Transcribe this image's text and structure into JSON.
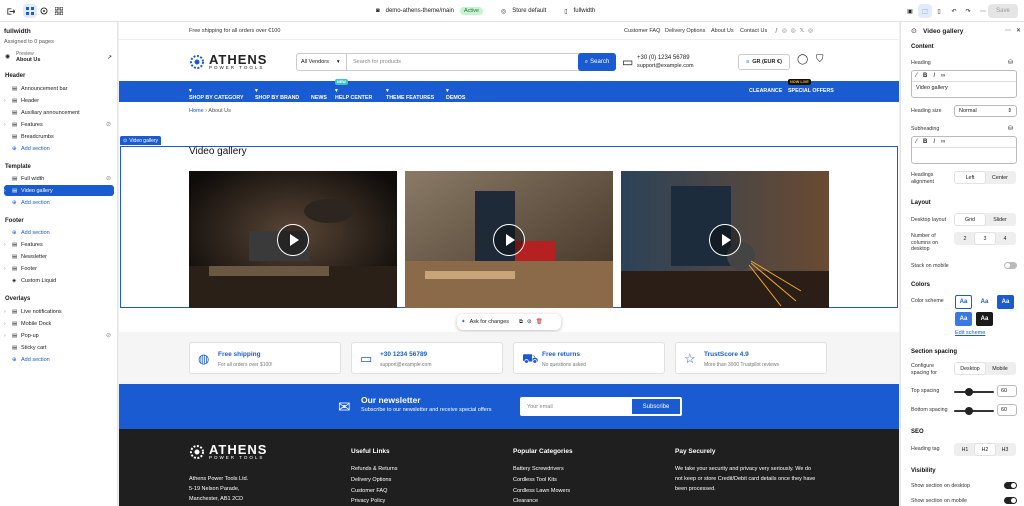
{
  "topbar": {
    "theme": "demo-athens-theme/main",
    "status": "Active",
    "store": "Store default",
    "template": "fullwidth",
    "save": "Save"
  },
  "left": {
    "title": "fullwidth",
    "assigned": "Assigned to 0 pages",
    "preview_label": "Preview",
    "preview_page": "About Us",
    "header_group": "Header",
    "header_items": [
      "Announcement bar",
      "Header",
      "Auxiliary announcement",
      "Features",
      "Breadcrumbs"
    ],
    "template_group": "Template",
    "template_items": [
      "Full width",
      "Video gallery"
    ],
    "footer_group": "Footer",
    "footer_items": [
      "Features",
      "Newsletter",
      "Footer",
      "Custom Liquid"
    ],
    "overlays_group": "Overlays",
    "overlay_items": [
      "Live notifications",
      "Mobile Dock",
      "Pop-up",
      "Sticky cart"
    ],
    "add_section": "Add section"
  },
  "store": {
    "shipping_msg": "Free shipping for all orders over €100",
    "top_links": [
      "Customer FAQ",
      "Delivery Options",
      "About Us",
      "Contact Us"
    ],
    "logo_name": "ATHENS",
    "logo_sub": "POWER TOOLS",
    "vendors": "All Vendors",
    "search_placeholder": "Search for products",
    "search_btn": "Search",
    "phone": "+30 (0) 1234 56789",
    "email": "support@example.com",
    "currency": "GR (EUR €)",
    "nav": [
      "SHOP BY CATEGORY",
      "SHOP BY BRAND",
      "NEWS",
      "HELP CENTER",
      "THEME FEATURES",
      "DEMOS",
      "CLEARANCE",
      "SPECIAL OFFERS"
    ],
    "tag_new": "NEW",
    "tag_live": "NOW LIVE",
    "crumb_home": "Home",
    "crumb_sep": "›",
    "crumb_page": "About Us",
    "section_label": "Video gallery",
    "gallery_title": "Video gallery",
    "ask": "Ask for changes",
    "features": [
      {
        "title": "Free shipping",
        "desc": "For all orders over $100!"
      },
      {
        "title": "+30 1234 56789",
        "desc": "support@example.com"
      },
      {
        "title": "Free returns",
        "desc": "No questions asked"
      },
      {
        "title": "TrustScore 4.9",
        "desc": "More than 3000 Trustpilot reviews"
      }
    ],
    "newsletter_title": "Our newsletter",
    "newsletter_sub": "Subscribe to our newsletter and receive special offers",
    "newsletter_placeholder": "Your email",
    "newsletter_btn": "Subscribe",
    "footer_address": [
      "Athens Power Tools Ltd.",
      "5-19 Nelson Parade,",
      "Manchester, AB1 2CD"
    ],
    "footer_h1": "Useful Links",
    "footer_links1": [
      "Refunds & Returns",
      "Delivery Options",
      "Customer FAQ",
      "Privacy Policy"
    ],
    "footer_h2": "Popular Categories",
    "footer_links2": [
      "Battery Screwdrivers",
      "Cordless Tool Kits",
      "Cordless Lawn Mowers",
      "Clearance"
    ],
    "footer_h3": "Pay Securely",
    "footer_pay": [
      "We take your security and privacy very seriously. We do",
      "not keep or store Credit/Debit card details once they have",
      "been processed."
    ]
  },
  "right": {
    "title": "Video gallery",
    "content": "Content",
    "heading": "Heading",
    "heading_value": "Video gallery",
    "heading_size": "Heading size",
    "heading_size_value": "Normal",
    "subheading": "Subheading",
    "align_label": "Headings alignment",
    "align": [
      "Left",
      "Center"
    ],
    "layout": "Layout",
    "desktop_layout": "Desktop layout",
    "layout_opts": [
      "Grid",
      "Slider"
    ],
    "columns_label": "Number of columns on desktop",
    "columns": [
      "2",
      "3",
      "4"
    ],
    "stack": "Stack on mobile",
    "colors": "Colors",
    "scheme": "Color scheme",
    "edit_scheme": "Edit scheme",
    "spacing": "Section spacing",
    "configure": "Configure spacing for",
    "spacing_opts": [
      "Desktop",
      "Mobile"
    ],
    "top": "Top spacing",
    "top_val": "60",
    "bottom": "Bottom spacing",
    "bottom_val": "60",
    "seo": "SEO",
    "heading_tag": "Heading tag",
    "tags": [
      "H1",
      "H2",
      "H3"
    ],
    "visibility": "Visibility",
    "show_desktop": "Show section on desktop",
    "show_mobile": "Show section on mobile"
  }
}
